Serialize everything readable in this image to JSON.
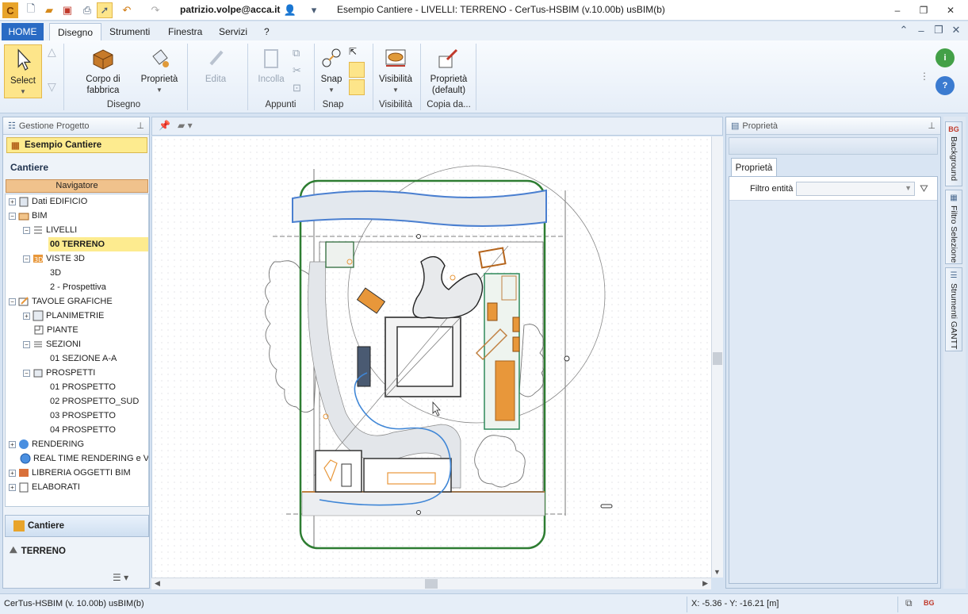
{
  "titlebar": {
    "user": "patrizio.volpe@acca.it",
    "title": "Esempio Cantiere -  LIVELLI: TERRENO - CerTus-HSBIM (v.10.00b) usBIM(b)",
    "minimize": "–",
    "restore": "❐",
    "close": "✕"
  },
  "tabs": {
    "home": "HOME",
    "disegno": "Disegno",
    "strumenti": "Strumenti",
    "finestra": "Finestra",
    "servizi": "Servizi",
    "help": "?"
  },
  "ribbon": {
    "select": "Select",
    "corpo": "Corpo di fabbrica",
    "proprieta": "Proprietà",
    "edita": "Edita",
    "incolla": "Incolla",
    "snap": "Snap",
    "visibilita": "Visibilità",
    "proprieta_default": "Proprietà (default)",
    "groups": {
      "disegno": "Disegno",
      "appunti": "Appunti",
      "snap": "Snap",
      "visibilita": "Visibilità",
      "copia": "Copia da..."
    }
  },
  "left_panel": {
    "header": "Gestione Progetto",
    "project": "Esempio Cantiere",
    "section": "Cantiere",
    "navigator": "Navigatore",
    "tree": {
      "dati_edificio": "Dati EDIFICIO",
      "bim": "BIM",
      "livelli": "LIVELLI",
      "terreno": "00 TERRENO",
      "viste3d": "VISTE 3D",
      "v3d": "3D",
      "prospettiva": "2 - Prospettiva",
      "tavole": "TAVOLE GRAFICHE",
      "planimetrie": "PLANIMETRIE",
      "piante": "PIANTE",
      "sezioni": "SEZIONI",
      "sezione_aa": "01 SEZIONE  A-A",
      "prospetti": "PROSPETTI",
      "p01": "01 PROSPETTO",
      "p02": "02 PROSPETTO_SUD",
      "p03": "03 PROSPETTO",
      "p04": "04 PROSPETTO",
      "rendering": "RENDERING",
      "realtime": "REAL TIME RENDERING e VRI",
      "libreria": "LIBRERIA OGGETTI BIM",
      "elaborati": "ELABORATI"
    },
    "tab_cantiere": "Cantiere",
    "tab_terreno": "TERRENO"
  },
  "right_panel": {
    "header": "Proprietà",
    "tab": "Proprietà",
    "filter_label": "Filtro entità",
    "filter_value": ""
  },
  "side_tabs": {
    "background": "Background",
    "filtro": "Filtro Selezione",
    "gantt": "Strumenti GANTT"
  },
  "status": {
    "left": "CerTus-HSBIM (v. 10.00b) usBIM(b)",
    "coords": "X: -5.36 - Y: -16.21 [m]"
  },
  "colors": {
    "accent": "#2a6bc4",
    "selection": "#fdeb8f",
    "navigator": "#f0c28c",
    "site_boundary": "#2e7d32",
    "water": "#4a7fd0",
    "orange_items": "#e8973a"
  }
}
